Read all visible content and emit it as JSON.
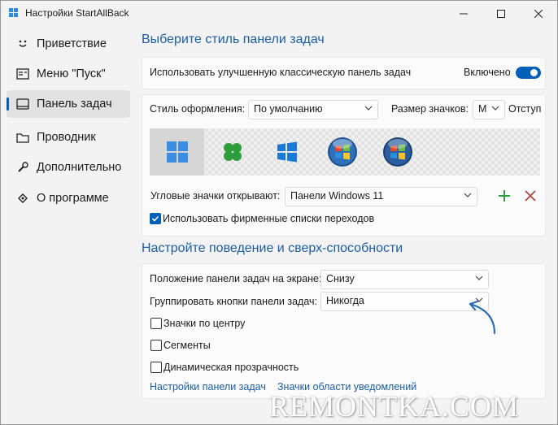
{
  "window": {
    "title": "Настройки StartAllBack"
  },
  "sidebar": {
    "items": [
      {
        "label": "Приветствие",
        "icon": "smile-icon"
      },
      {
        "label": "Меню \"Пуск\"",
        "icon": "start-menu-icon"
      },
      {
        "label": "Панель задач",
        "icon": "taskbar-icon",
        "active": true
      },
      {
        "label": "Проводник",
        "icon": "folder-icon"
      },
      {
        "label": "Дополнительно",
        "icon": "wrench-icon"
      },
      {
        "label": "О программе",
        "icon": "about-icon"
      }
    ]
  },
  "section1": {
    "title": "Выберите стиль панели задач",
    "enhanced": {
      "label": "Использовать улучшенную классическую панель задач",
      "state_label": "Включено",
      "on": true
    },
    "style": {
      "label": "Стиль оформления:",
      "value": "По умолчанию"
    },
    "icon_size": {
      "label": "Размер значков:",
      "value": "M"
    },
    "indent_label": "Отступ",
    "style_options": [
      "windows-11-style-icon",
      "clover-style-icon",
      "windows-10-style-icon",
      "windows-7-orb-icon",
      "windows-vista-orb-icon"
    ],
    "corner": {
      "label": "Угловые значки открывают:",
      "value": "Панели Windows 11"
    },
    "jumplists": {
      "label": "Использовать фирменные списки переходов",
      "checked": true
    }
  },
  "section2": {
    "title": "Настройте поведение и сверх-способности",
    "position": {
      "label": "Положение панели задач на экране:",
      "value": "Снизу"
    },
    "grouping": {
      "label": "Группировать кнопки панели задач:",
      "value": "Никогда"
    },
    "center_icons": {
      "label": "Значки по центру",
      "checked": false
    },
    "segments": {
      "label": "Сегменты",
      "checked": false
    },
    "transparency": {
      "label": "Динамическая прозрачность",
      "checked": false
    },
    "links": [
      "Настройки панели задач",
      "Значки области уведомлений"
    ]
  },
  "colors": {
    "accent": "#005fb8",
    "link": "#1a5ea7",
    "add": "#2e9e3c",
    "remove": "#b04a3e"
  },
  "watermark": "REMONTKA.COM"
}
